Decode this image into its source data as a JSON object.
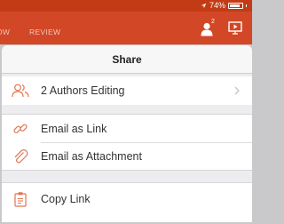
{
  "status_bar": {
    "battery_percent": "74%"
  },
  "ribbon": {
    "tab_partial": "OW",
    "tab_review": "REVIEW",
    "share_badge": "2",
    "accent_color": "#d24726"
  },
  "share_panel": {
    "title": "Share",
    "rows": [
      {
        "label": "2 Authors Editing",
        "icon": "people-icon",
        "has_chevron": true
      },
      {
        "label": "Email as Link",
        "icon": "link-icon"
      },
      {
        "label": "Email as Attachment",
        "icon": "paperclip-icon"
      },
      {
        "label": "Copy Link",
        "icon": "clipboard-icon"
      }
    ],
    "icon_color": "#e2734f"
  }
}
